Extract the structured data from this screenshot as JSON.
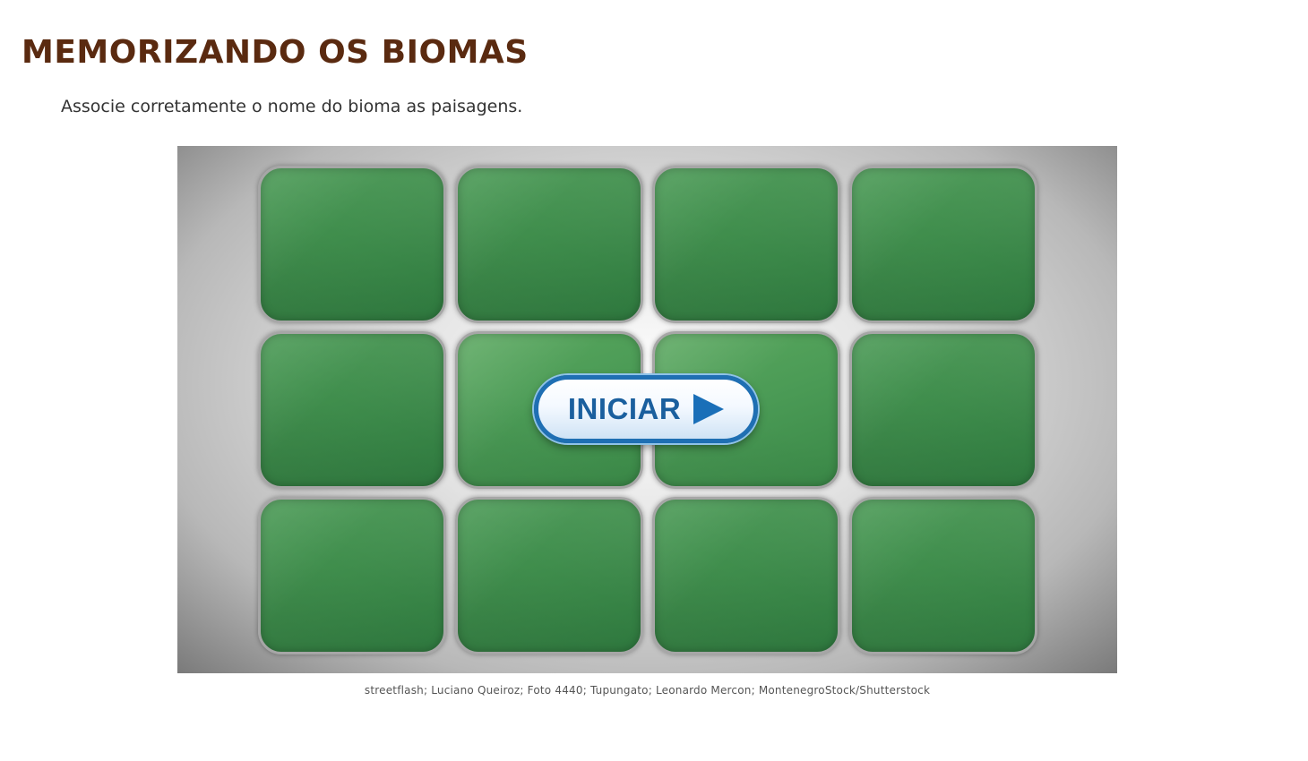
{
  "header": {
    "title": "MEMORIZANDO OS BIOMAS",
    "instructions": "Associe corretamente o nome do bioma as paisagens."
  },
  "game": {
    "card_count": 12,
    "grid": {
      "rows": 3,
      "columns": 4
    },
    "card_state": "face-down",
    "start_button": {
      "label": "INICIAR",
      "icon": "play-icon"
    },
    "colors": {
      "card_green": "#3f8d4c",
      "button_blue": "#1f6fb3",
      "title_brown": "#5a2a10"
    }
  },
  "footer": {
    "credits": "streetflash; Luciano Queiroz; Foto 4440; Tupungato; Leonardo Mercon; MontenegroStock/Shutterstock"
  }
}
